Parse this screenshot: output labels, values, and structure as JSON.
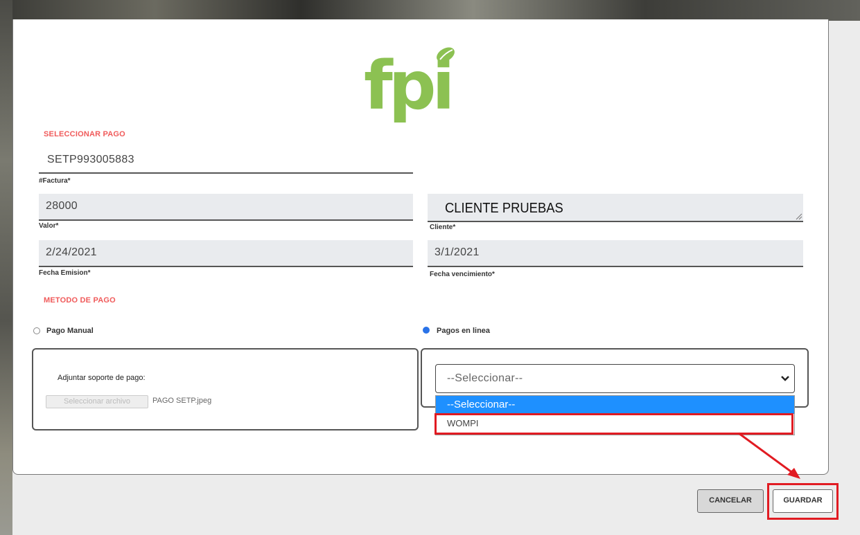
{
  "logo": {
    "text": "fpi",
    "color": "#8cc152"
  },
  "sections": {
    "select_payment": "SELECCIONAR PAGO",
    "payment_method": "METODO DE PAGO"
  },
  "invoice": {
    "value": "SETP993005883",
    "label": "#Factura*"
  },
  "amount": {
    "value": "28000",
    "label": "Valor*"
  },
  "client": {
    "value": "CLIENTE PRUEBAS",
    "label": "Cliente*"
  },
  "issue_date": {
    "value": "2/24/2021",
    "label": "Fecha Emision*"
  },
  "due_date": {
    "value": "3/1/2021",
    "label": "Fecha vencimiento*"
  },
  "methods": {
    "manual_label": "Pago Manual",
    "online_label": "Pagos en linea",
    "selected": "Pagos en linea"
  },
  "manual_panel": {
    "attach_label": "Adjuntar soporte de pago:",
    "file_button": "Seleccionar archivo",
    "file_name": "PAGO SETP.jpeg"
  },
  "online_panel": {
    "select_value": "--Seleccionar--",
    "options": [
      "--Seleccionar--",
      "WOMPI"
    ]
  },
  "buttons": {
    "cancel": "CANCELAR",
    "save": "GUARDAR"
  },
  "colors": {
    "accent_red": "#f05a5a",
    "highlight_red": "#e11b22",
    "option_blue": "#1e90ff",
    "radio_blue": "#2a73e8"
  }
}
